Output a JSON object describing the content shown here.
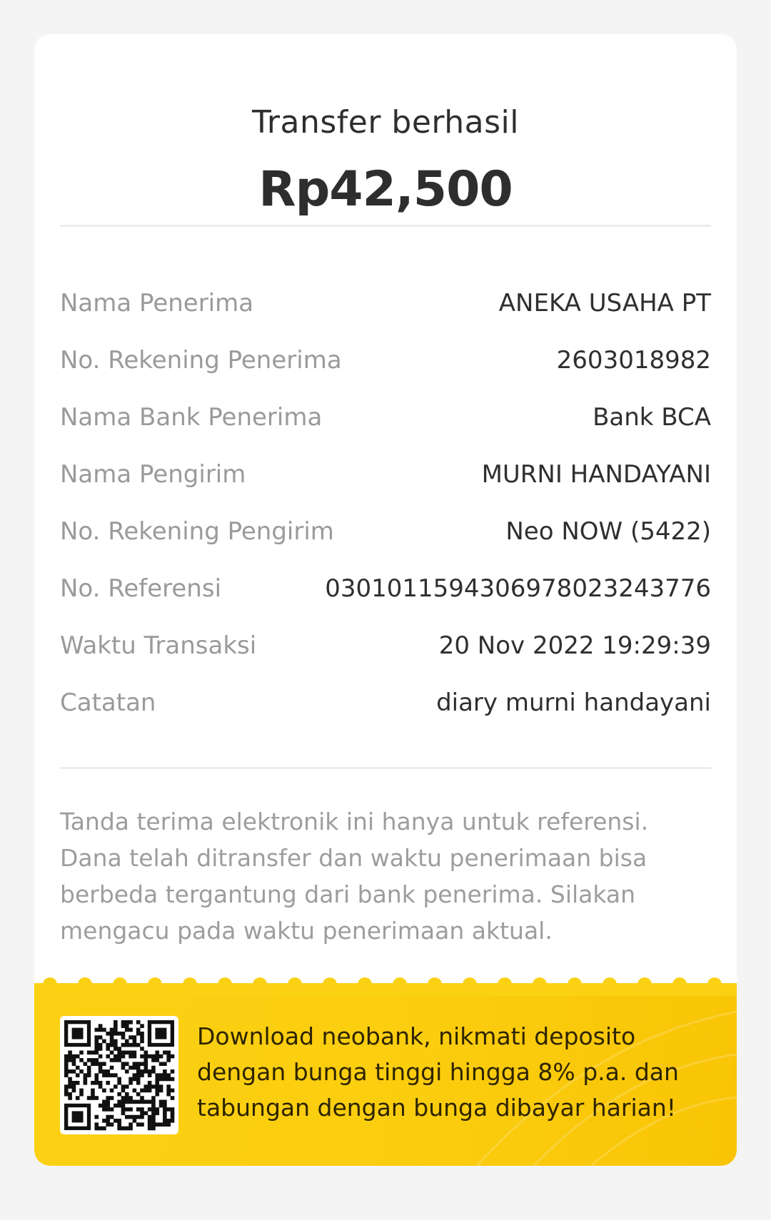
{
  "receipt": {
    "title": "Transfer berhasil",
    "amount": "Rp42,500",
    "rows": [
      {
        "label": "Nama Penerima",
        "value": "ANEKA USAHA PT"
      },
      {
        "label": "No. Rekening Penerima",
        "value": "2603018982"
      },
      {
        "label": "Nama Bank Penerima",
        "value": "Bank BCA"
      },
      {
        "label": "Nama Pengirim",
        "value": "MURNI HANDAYANI"
      },
      {
        "label": "No. Rekening Pengirim",
        "value": "Neo NOW (5422)"
      },
      {
        "label": "No. Referensi",
        "value": "03010115943069780232437​76"
      },
      {
        "label": "Waktu Transaksi",
        "value": "20 Nov 2022 19:29:39"
      },
      {
        "label": "Catatan",
        "value": "diary murni handayani"
      }
    ],
    "note": "Tanda terima elektronik ini hanya untuk referensi. Dana telah ditransfer dan waktu penerimaan bisa berbeda tergantung dari bank penerima. Silakan mengacu pada waktu penerimaan aktual."
  },
  "promo": {
    "text": "Download neobank, nikmati deposito dengan bunga tinggi hingga 8% p.a. dan tabungan dengan bunga dibayar harian!",
    "qr_icon": "qr-code-icon"
  },
  "colors": {
    "background": "#f4f4f4",
    "card": "#ffffff",
    "promo_yellow": "#fbd113",
    "label_gray": "#9a9a9a",
    "text_dark": "#2e2e2e"
  }
}
